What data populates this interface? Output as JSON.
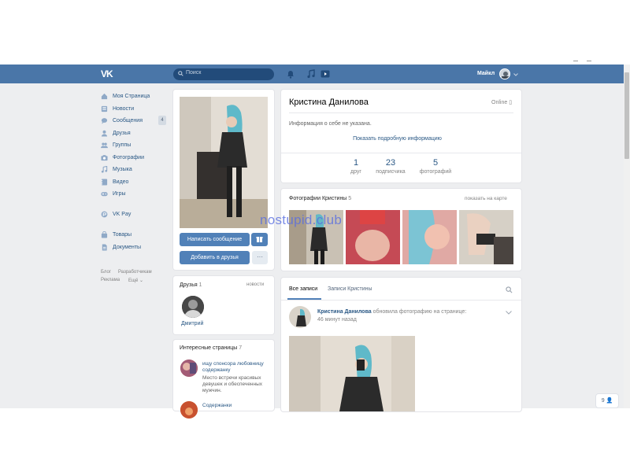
{
  "header": {
    "logo": "VK",
    "search_placeholder": "Поиск",
    "user_name": "Майкл"
  },
  "sidebar": {
    "items": [
      {
        "label": "Моя Страница",
        "icon": "home-icon"
      },
      {
        "label": "Новости",
        "icon": "news-icon"
      },
      {
        "label": "Сообщения",
        "icon": "chat-icon",
        "badge": "4"
      },
      {
        "label": "Друзья",
        "icon": "friend-icon"
      },
      {
        "label": "Группы",
        "icon": "group-icon"
      },
      {
        "label": "Фотографии",
        "icon": "camera-icon"
      },
      {
        "label": "Музыка",
        "icon": "music-icon"
      },
      {
        "label": "Видео",
        "icon": "video-icon"
      },
      {
        "label": "Игры",
        "icon": "gamepad-icon"
      },
      {
        "label": "VK Pay",
        "icon": "pay-icon"
      },
      {
        "label": "Товары",
        "icon": "shop-icon"
      },
      {
        "label": "Документы",
        "icon": "doc-icon"
      }
    ],
    "footer": [
      "Блог",
      "Разработчикам",
      "Реклама",
      "Ещё ⌄"
    ]
  },
  "profile": {
    "write_btn": "Написать сообщение",
    "add_btn": "Добавить в друзья",
    "more_btn": "···"
  },
  "friends": {
    "title": "Друзья",
    "count": "1",
    "right": "новости",
    "name": "Дмитрий"
  },
  "interesting": {
    "title": "Интересные страницы",
    "count": "7",
    "item1_title": "ищу спонсора любовницу содержанку",
    "item1_desc": "Место встречи красивых девушек и обеспеченных мужчин.",
    "item2_title": "Содержанки"
  },
  "info": {
    "name": "Кристина Данилова",
    "status": "Online",
    "about": "Информация о себе не указана.",
    "show_more": "Показать подробную информацию",
    "stats": [
      {
        "num": "1",
        "label": "друг"
      },
      {
        "num": "23",
        "label": "подписчика"
      },
      {
        "num": "5",
        "label": "фотографий"
      }
    ]
  },
  "photos": {
    "title": "Фотографии Кристины",
    "count": "5",
    "right": "показать на карте"
  },
  "wall": {
    "tab1": "Все записи",
    "tab2": "Записи Кристины",
    "post_author": "Кристина Данилова",
    "post_action": "обновила фотографию на странице:",
    "post_time": "46 минут назад"
  },
  "chat_badge": "9",
  "watermark": "nostupid.club"
}
